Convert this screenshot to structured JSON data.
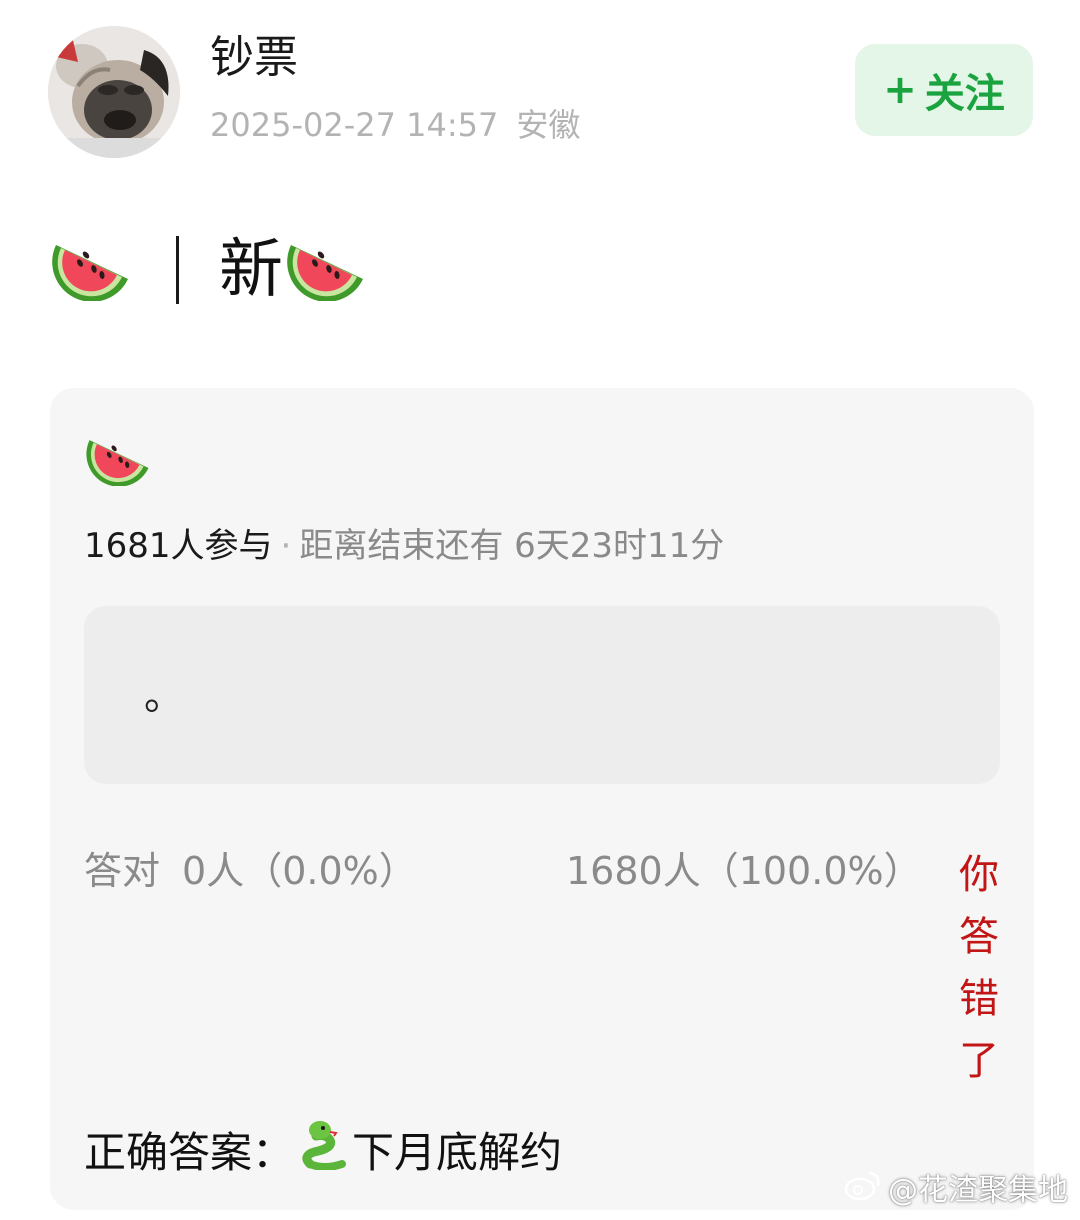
{
  "header": {
    "author_name": "钞票",
    "post_date": "2025-02-27 14:57",
    "post_location": "安徽",
    "follow_plus": "+",
    "follow_label": "关注"
  },
  "post": {
    "title_text": "新",
    "title_icons": [
      "watermelon-icon",
      "watermelon-icon"
    ]
  },
  "quiz": {
    "icon": "watermelon-icon",
    "participants": "1681人参与",
    "separator": "·",
    "countdown": "距离结束还有 6天23时11分",
    "option_text": "。",
    "correct_label": "答对",
    "correct_count": "0人（0.0%）",
    "wrong_count": "1680人（100.0%）",
    "wrong_notice": "你答错了",
    "answer_label": "正确答案：",
    "answer_icon": "snake-icon",
    "answer_text": "下月底解约"
  },
  "watermark": {
    "icon": "weibo-logo",
    "text": "@花渣聚集地"
  },
  "colors": {
    "follow_text": "#1aa33e",
    "follow_bg": "#e4f6e8",
    "wrong_notice": "#c21515",
    "card_bg": "#f6f6f6",
    "option_bg": "#ededed",
    "muted_text": "#8a8a8a"
  }
}
